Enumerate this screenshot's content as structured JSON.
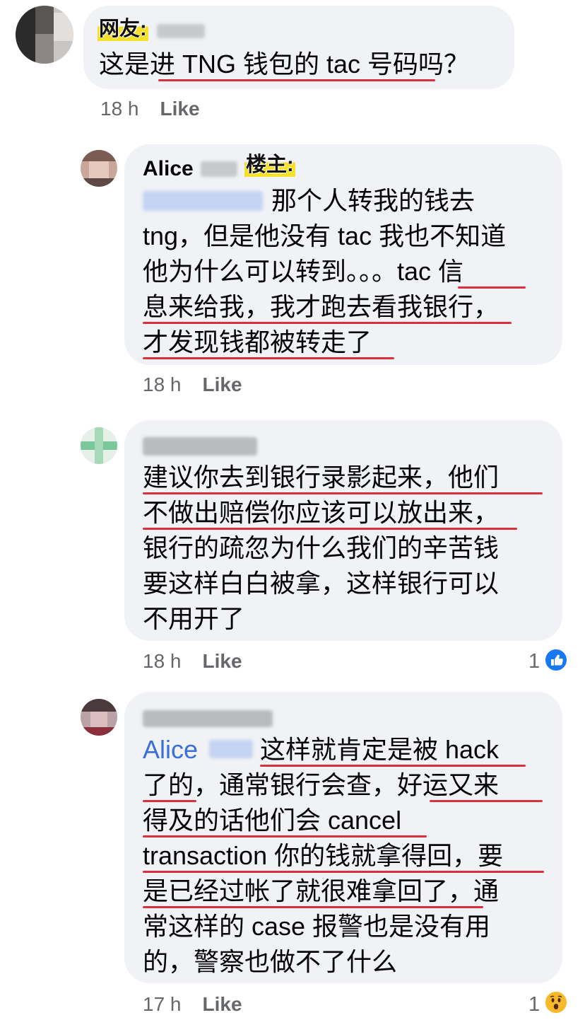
{
  "comments": [
    {
      "tag": "网友:",
      "name": "",
      "lines": [
        "这是进 TNG 钱包的 tac 号码吗？"
      ],
      "time": "18 h",
      "like": "Like"
    },
    {
      "name": "Alice",
      "tag": "楼主:",
      "lines": [
        "那个人转我的钱去",
        "tng，但是他没有 tac 我也不知道",
        "他为什么可以转到。。。tac 信",
        "息来给我，我才跑去看我银行，",
        "才发现钱都被转走了"
      ],
      "time": "18 h",
      "like": "Like"
    },
    {
      "name": "",
      "lines": [
        "建议你去到银行录影起来，他们",
        "不做出赔偿你应该可以放出来，",
        "银行的疏忽为什么我们的辛苦钱",
        "要这样白白被拿，这样银行可以",
        "不用开了"
      ],
      "time": "18 h",
      "like": "Like",
      "reaction_count": "1",
      "reaction_icon": "like-reaction-icon"
    },
    {
      "name": "",
      "mention": "Alice",
      "lines": [
        "这样就肯定是被 hack",
        "了的，通常银行会查，好运又来",
        "得及的话他们会 cancel",
        "transaction 你的钱就拿得回，要",
        "是已经过帐了就很难拿回了，通",
        "常这样的 case 报警也是没有用",
        "的，警察也做不了什么"
      ],
      "time": "17 h",
      "like": "Like",
      "reaction_count": "1",
      "reaction_icon": "wow-reaction-icon"
    }
  ],
  "colors": {
    "bubble": "#f0f2f5",
    "underline": "#d8303c",
    "mention": "#3b6fd8",
    "tag_highlight": "#f5e12b",
    "meta": "#65676b",
    "like_blue": "#1877f2",
    "wow_yellow": "#f7b928"
  }
}
